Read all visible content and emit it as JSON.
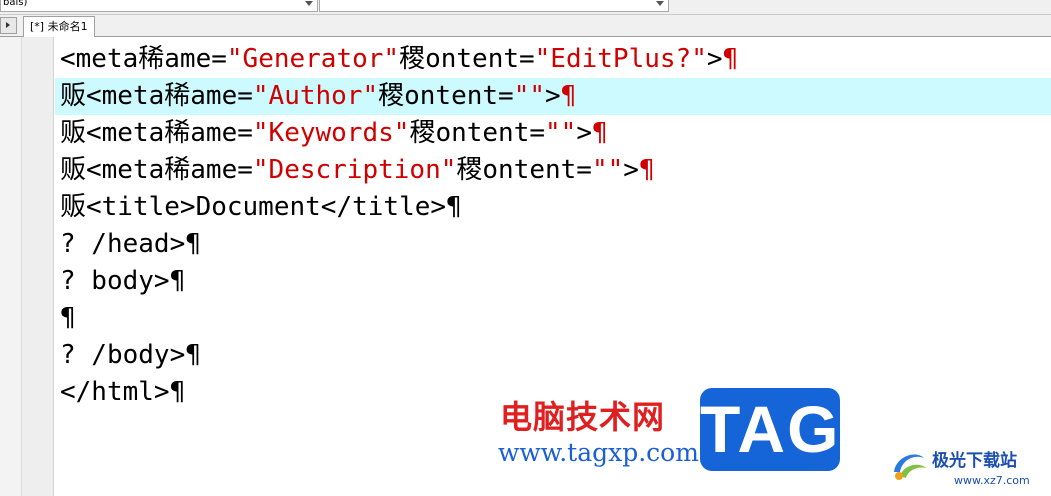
{
  "toolbar": {
    "combo1_value": "bals)",
    "combo2_value": ""
  },
  "tabs": [
    {
      "label": "[*] 未命名1"
    }
  ],
  "editor": {
    "lines": [
      {
        "t1": "<meta稀ame=",
        "s1": "\"Generator\"",
        "t2": "稷ontent=",
        "s2": "\"EditPlus?\"",
        "t3": ">",
        "pilcrow": "¶",
        "pilcrow_red": true
      },
      {
        "t1": "贩<meta稀ame=",
        "s1": "\"Author\"",
        "t2": "稷ontent=",
        "s2": "\"\"",
        "t3": ">",
        "pilcrow": "¶",
        "pilcrow_red": true
      },
      {
        "t1": "贩<meta稀ame=",
        "s1": "\"Keywords\"",
        "t2": "稷ontent=",
        "s2": "\"\"",
        "t3": ">",
        "pilcrow": "¶",
        "pilcrow_red": true
      },
      {
        "t1": "贩<meta稀ame=",
        "s1": "\"Description\"",
        "t2": "稷ontent=",
        "s2": "\"\"",
        "t3": ">",
        "pilcrow": "¶",
        "pilcrow_red": true
      },
      {
        "t1": "贩<title>Document</title>",
        "pilcrow": "¶"
      },
      {
        "t1": "? /head>",
        "pilcrow": "¶"
      },
      {
        "t1": "? body>",
        "pilcrow": "¶"
      },
      {
        "t1": "",
        "pilcrow": "¶"
      },
      {
        "t1": "? /body>",
        "pilcrow": "¶"
      },
      {
        "t1": "</html>",
        "pilcrow": "¶"
      }
    ],
    "current_line_index": 1
  },
  "watermark": {
    "cn_text": "电脑技术网",
    "url": "www.tagxp.com",
    "badge": "TAG",
    "site_name": "极光下载站",
    "site_url": "www.xz7.com"
  },
  "colors": {
    "string": "#d00000",
    "current_line": "#ccfaff",
    "badge": "#1565d8"
  }
}
